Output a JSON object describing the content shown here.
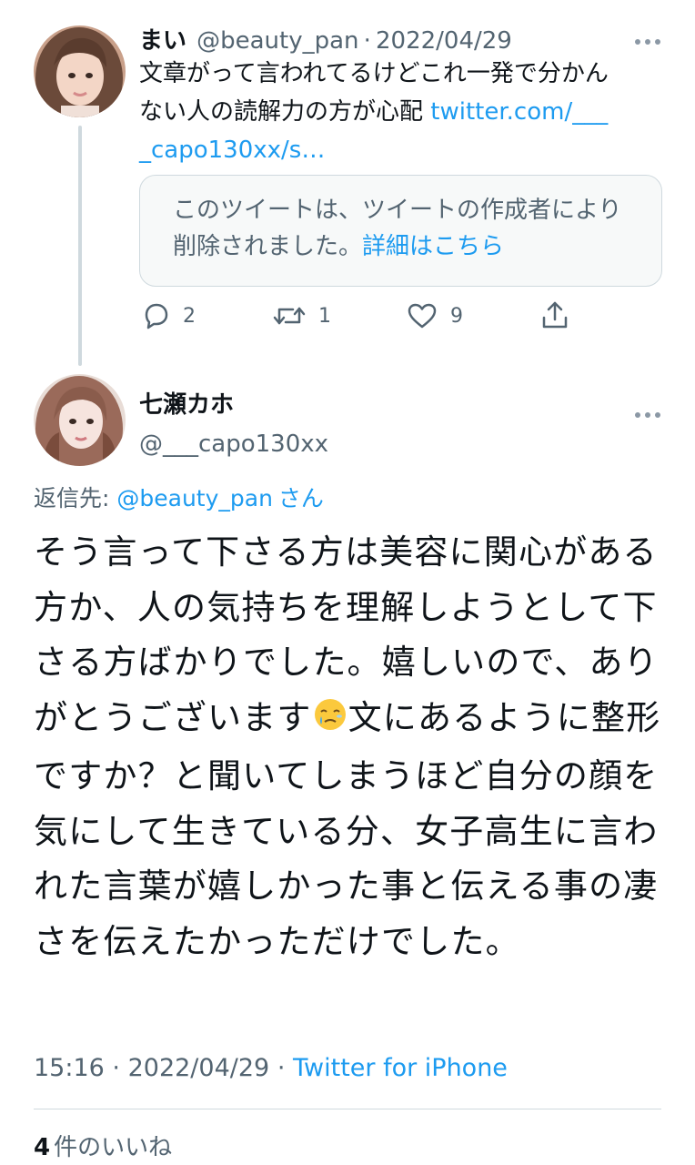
{
  "tweet1": {
    "display_name": "まい",
    "handle": "@beauty_pan",
    "separator": "·",
    "date": "2022/04/29",
    "text": "文章がって言われてるけどこれ一発で分かんない人の読解力の方が心配",
    "link_text": "twitter.com/____capo130xx/s…",
    "quote_text": "このツイートは、ツイートの作成者により削除されました。",
    "quote_link": "詳細はこちら",
    "actions": {
      "reply_count": "2",
      "retweet_count": "1",
      "like_count": "9"
    },
    "more_icon": "more-dots-icon"
  },
  "tweet2": {
    "display_name": "七瀬カホ",
    "handle": "@___capo130xx",
    "replying_prefix": "返信先: ",
    "replying_handle": "@beauty_pan",
    "replying_suffix": "さん",
    "text_before_emoji": "そう言って下さる方は美容に関心がある方か、人の気持ちを理解しようとして下さる方ばかりでした。嬉しいので、ありがとうございます",
    "emoji": "face-holding-back-tears",
    "text_after_emoji": "文にあるように整形ですか？と聞いてしまうほど自分の顔を気にして生きている分、女子高生に言われた言葉が嬉しかった事と伝える事の凄さを伝えたかっただけでした。",
    "time": "15:16",
    "date": "2022/04/29",
    "separator": "·",
    "client": "Twitter for iPhone",
    "likes_count": "4",
    "likes_label": "件のいいね"
  },
  "colors": {
    "link": "#1d9bf0",
    "secondary_text": "#536471",
    "primary_text": "#0f1419",
    "border": "#cfd9de"
  }
}
